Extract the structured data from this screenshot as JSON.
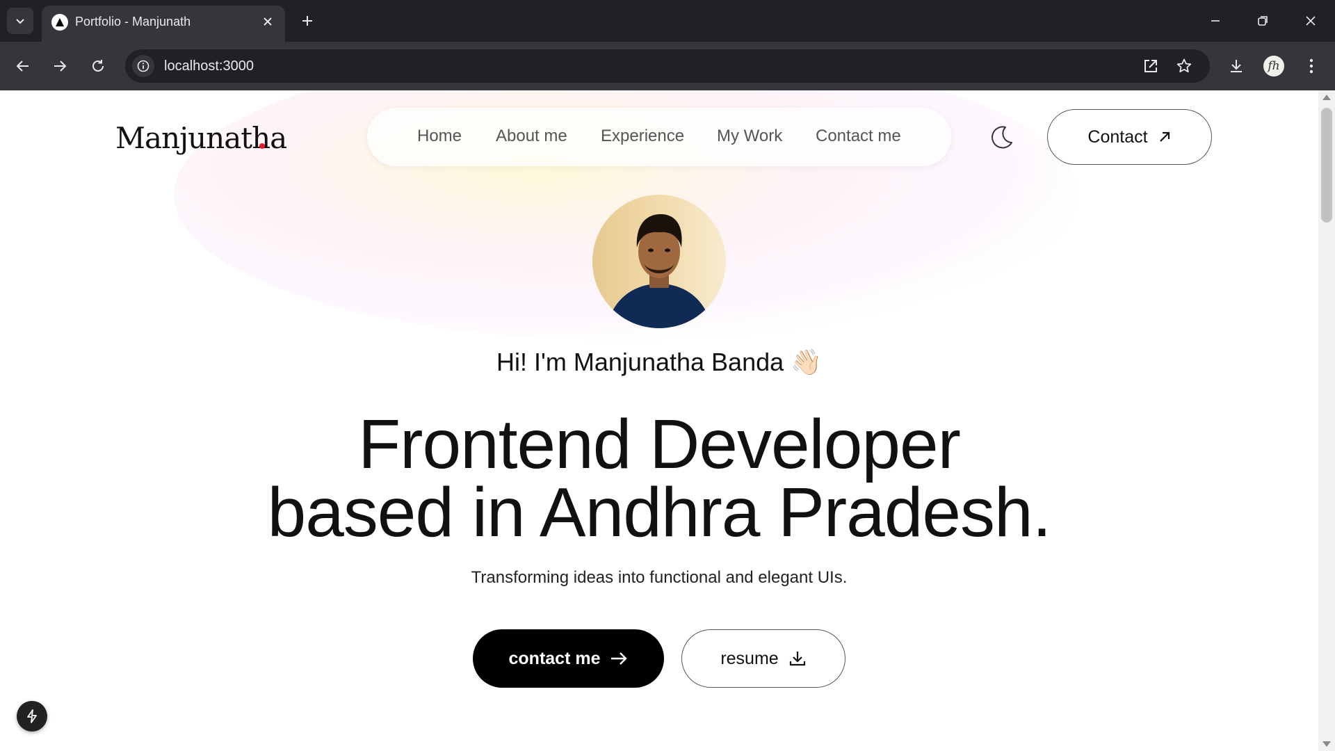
{
  "browser": {
    "tab_title": "Portfolio - Manjunath",
    "url": "localhost:3000",
    "profile_initials": "fh"
  },
  "site": {
    "logo_text": "Manjunatha",
    "nav_links": [
      "Home",
      "About me",
      "Experience",
      "My Work",
      "Contact me"
    ],
    "contact_button": "Contact",
    "greeting": "Hi! I'm Manjunatha Banda 👋🏻",
    "headline_line1": "Frontend Developer",
    "headline_line2": "based in Andhra Pradesh.",
    "tagline": "Transforming ideas into functional and elegant UIs.",
    "cta_primary": "contact me",
    "cta_secondary": "resume"
  },
  "colors": {
    "accent_dot": "#e11d2a",
    "primary_button": "#000000",
    "chrome_dark": "#202124",
    "chrome_toolbar": "#35363a"
  }
}
